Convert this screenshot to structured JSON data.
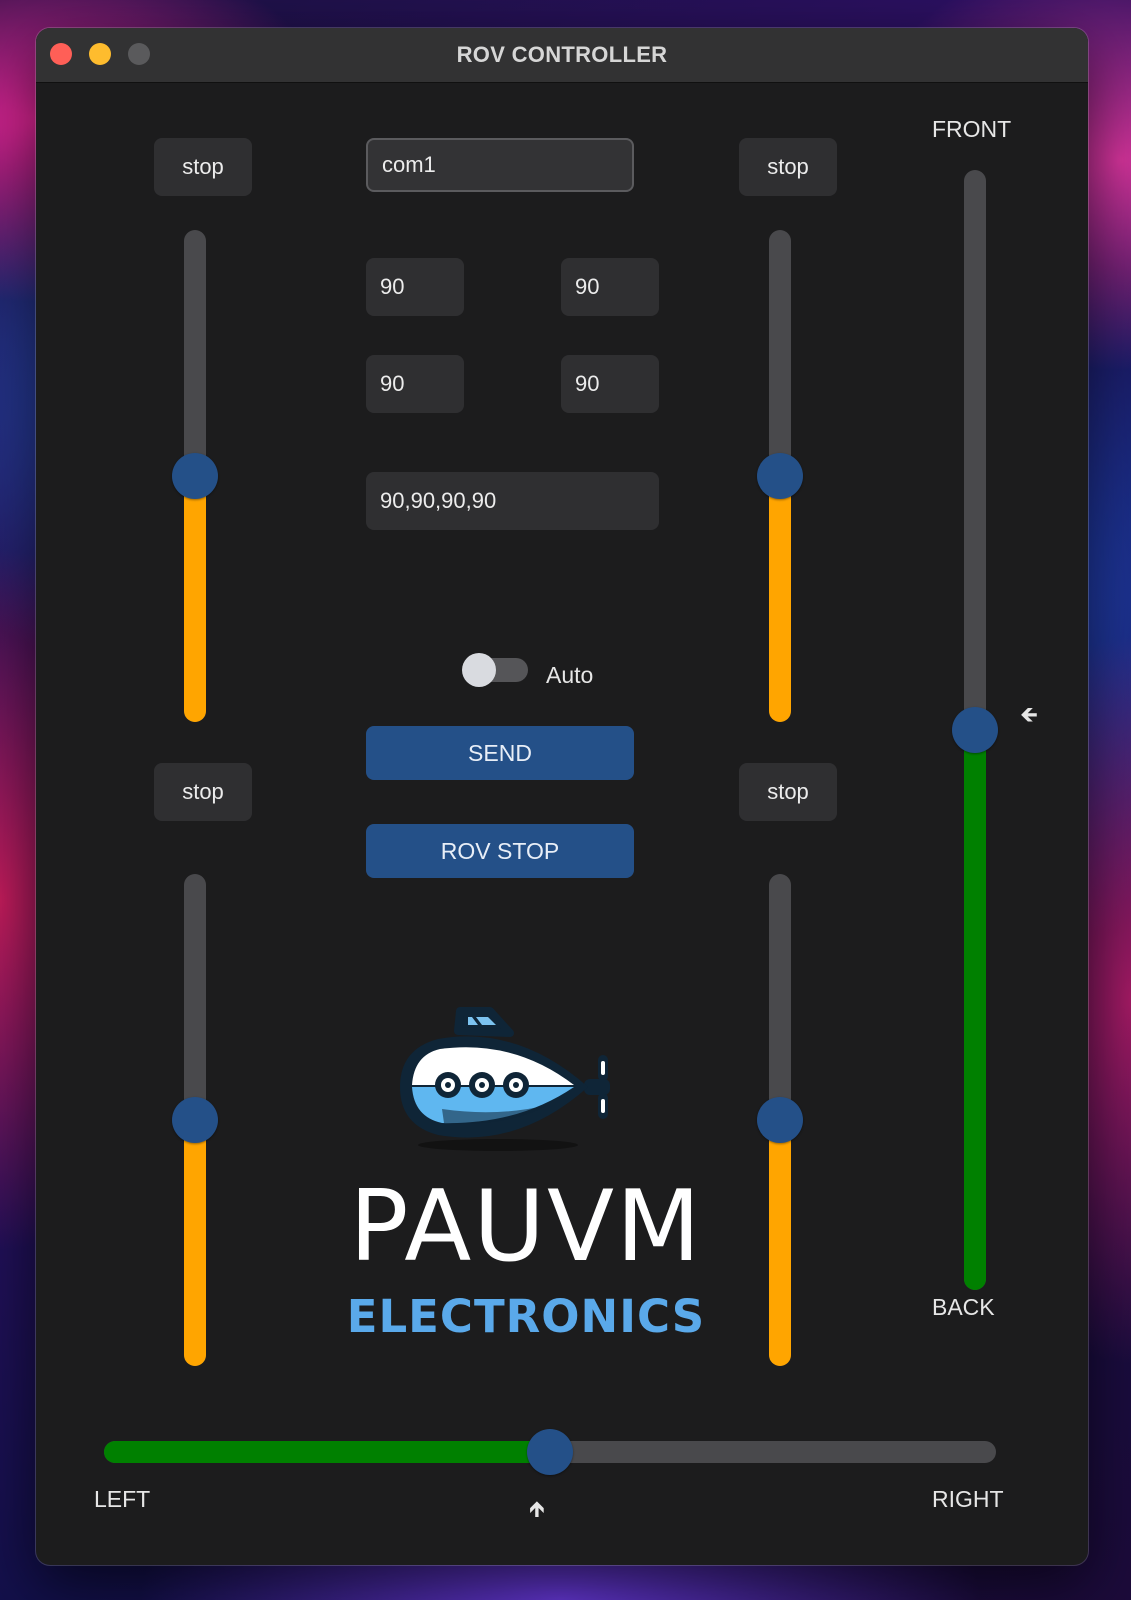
{
  "window": {
    "title": "ROV CONTROLLER"
  },
  "port": {
    "value": "com1"
  },
  "motors": {
    "top_left": {
      "status": "stop",
      "level": 0.5
    },
    "top_right": {
      "status": "stop",
      "level": 0.5
    },
    "bottom_left": {
      "status": "stop",
      "level": 0.5
    },
    "bottom_right": {
      "status": "stop",
      "level": 0.5
    }
  },
  "values": {
    "v1": "90",
    "v2": "90",
    "v3": "90",
    "v4": "90",
    "combined": "90,90,90,90"
  },
  "auto_toggle": {
    "label": "Auto",
    "on": false
  },
  "buttons": {
    "send": "SEND",
    "rov_stop": "ROV STOP"
  },
  "logo": {
    "name": "PAUVM",
    "subtitle": "ELECTRONICS",
    "icon": "submarine-icon"
  },
  "vertical_slider": {
    "top_label": "FRONT",
    "bottom_label": "BACK",
    "level": 0.5,
    "indicator_icon": "arrow-left-icon"
  },
  "horizontal_slider": {
    "left_label": "LEFT",
    "right_label": "RIGHT",
    "level": 0.5,
    "indicator_icon": "arrow-up-icon"
  },
  "colors": {
    "accent": "#245088",
    "motor_fill": "#ffa500",
    "direction_fill": "#008000",
    "track": "#49494c"
  }
}
